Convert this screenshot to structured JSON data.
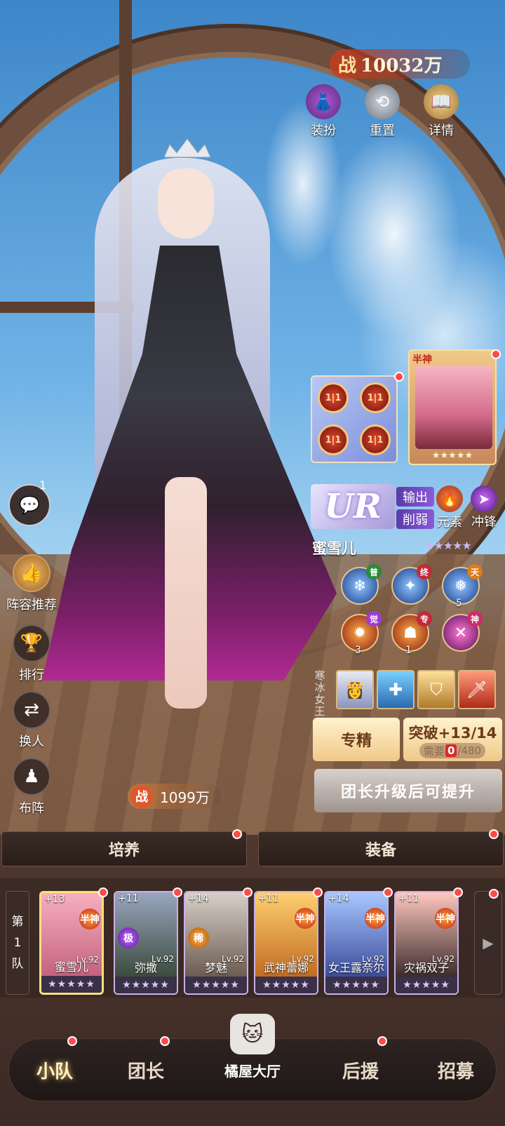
{
  "top": {
    "power_char": "战",
    "power_value": "10032万",
    "icons": [
      {
        "label": "装扮",
        "icon": "outfit-icon"
      },
      {
        "label": "重置",
        "icon": "reset-icon"
      },
      {
        "label": "详情",
        "icon": "book-icon"
      }
    ]
  },
  "left": {
    "chat_count": "1",
    "buttons": [
      {
        "label": "阵容推荐",
        "icon": "thumbs-up-icon"
      },
      {
        "label": "排行",
        "icon": "trophy-icon"
      },
      {
        "label": "换人",
        "icon": "swap-icon"
      },
      {
        "label": "布阵",
        "icon": "formation-icon"
      }
    ]
  },
  "hero": {
    "rarity": "UR",
    "roles": [
      "输出",
      "削弱"
    ],
    "elements": [
      {
        "label": "元素",
        "icon": "fire-element-icon"
      },
      {
        "label": "冲锋",
        "icon": "charge-icon"
      }
    ],
    "name": "蜜雪儿",
    "stars": "★★★★★",
    "chip_label": "1|1",
    "soul_rank": "半神",
    "skills": [
      {
        "badge": "普",
        "num": ""
      },
      {
        "badge": "终",
        "num": ""
      },
      {
        "badge": "天",
        "num": "5"
      },
      {
        "badge": "觉",
        "num": "3"
      },
      {
        "badge": "专",
        "num": "1"
      },
      {
        "badge": "神",
        "num": ""
      }
    ],
    "title_label": "寒冰女王",
    "specialize_label": "专精",
    "breakthrough_label": "突破+13/14",
    "need_label": "需要",
    "need_have": "0",
    "need_total": "/480",
    "upgrade_hint": "团长升级后可提升",
    "power_char": "战",
    "power_value": "1099万"
  },
  "tabs": [
    "培养",
    "装备"
  ],
  "team": {
    "label_chars": [
      "第",
      "1",
      "队"
    ],
    "members": [
      {
        "plus": "+13",
        "rank": "半神",
        "rank_type": "ban",
        "lv": "Lv.92",
        "name": "蜜雪儿",
        "stars": "★★★★★",
        "colors": [
          "#f7b0c0",
          "#c2607c"
        ]
      },
      {
        "plus": "+11",
        "rank": "极",
        "rank_type": "ji",
        "lv": "Lv.92",
        "name": "弥撒",
        "stars": "★★★★★",
        "colors": [
          "#9aa6c0",
          "#3a4a3a"
        ]
      },
      {
        "plus": "+14",
        "rank": "稀",
        "rank_type": "xi",
        "lv": "Lv.92",
        "name": "梦魅",
        "stars": "★★★★★",
        "colors": [
          "#d8d0c8",
          "#6a5a50"
        ]
      },
      {
        "plus": "+11",
        "rank": "半神",
        "rank_type": "ban",
        "lv": "Lv.92",
        "name": "武神蕾娜",
        "stars": "★★★★★",
        "colors": [
          "#ffd070",
          "#c06a20"
        ]
      },
      {
        "plus": "+14",
        "rank": "半神",
        "rank_type": "ban",
        "lv": "Lv.92",
        "name": "女王露奈尔",
        "stars": "★★★★★",
        "colors": [
          "#a8c8ff",
          "#3a4a9a"
        ]
      },
      {
        "plus": "+11",
        "rank": "半神",
        "rank_type": "ban",
        "lv": "Lv.92",
        "name": "灾祸双子",
        "stars": "★★★★★",
        "colors": [
          "#ffc8c0",
          "#3a2a2a"
        ]
      }
    ],
    "more_glyph": "▶"
  },
  "nav": {
    "items": [
      "小队",
      "团长",
      "后援",
      "招募"
    ],
    "home_label": "橘屋大厅",
    "active": "小队"
  }
}
